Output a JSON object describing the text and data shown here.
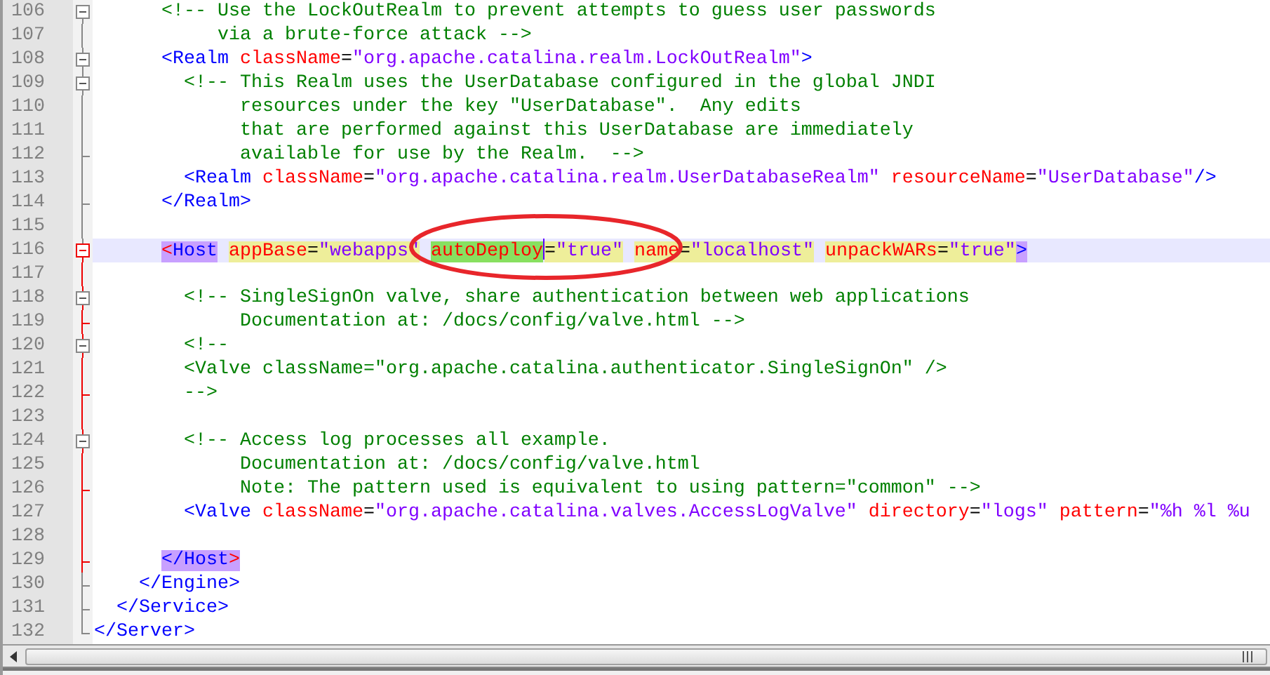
{
  "editor": {
    "lines": [
      {
        "number": "106",
        "fold": {
          "kind": "open",
          "active": false
        },
        "current": false,
        "tokens": [
          {
            "kind": "comment",
            "text": "      <!-- Use the LockOutRealm to prevent attempts to guess user passwords"
          }
        ]
      },
      {
        "number": "107",
        "fold": {
          "kind": "line",
          "active": false
        },
        "current": false,
        "tokens": [
          {
            "kind": "comment",
            "text": "           via a brute-force attack -->"
          }
        ]
      },
      {
        "number": "108",
        "fold": {
          "kind": "open",
          "active": false
        },
        "current": false,
        "tokens": [
          {
            "kind": "tag",
            "text": "      <Realm"
          },
          {
            "kind": "attr",
            "text": " className"
          },
          {
            "kind": "eq",
            "text": "="
          },
          {
            "kind": "value",
            "text": "\"org.apache.catalina.realm.LockOutRealm\""
          },
          {
            "kind": "tag",
            "text": ">"
          }
        ]
      },
      {
        "number": "109",
        "fold": {
          "kind": "open",
          "active": false
        },
        "current": false,
        "tokens": [
          {
            "kind": "comment",
            "text": "        <!-- This Realm uses the UserDatabase configured in the global JNDI"
          }
        ]
      },
      {
        "number": "110",
        "fold": {
          "kind": "line",
          "active": false
        },
        "current": false,
        "tokens": [
          {
            "kind": "comment",
            "text": "             resources under the key \"UserDatabase\".  Any edits"
          }
        ]
      },
      {
        "number": "111",
        "fold": {
          "kind": "line",
          "active": false
        },
        "current": false,
        "tokens": [
          {
            "kind": "comment",
            "text": "             that are performed against this UserDatabase are immediately"
          }
        ]
      },
      {
        "number": "112",
        "fold": {
          "kind": "end",
          "active": false
        },
        "current": false,
        "tokens": [
          {
            "kind": "comment",
            "text": "             available for use by the Realm.  -->"
          }
        ]
      },
      {
        "number": "113",
        "fold": {
          "kind": "line",
          "active": false
        },
        "current": false,
        "tokens": [
          {
            "kind": "tag",
            "text": "        <Realm"
          },
          {
            "kind": "attr",
            "text": " className"
          },
          {
            "kind": "eq",
            "text": "="
          },
          {
            "kind": "value",
            "text": "\"org.apache.catalina.realm.UserDatabaseRealm\""
          },
          {
            "kind": "attr",
            "text": " resourceName"
          },
          {
            "kind": "eq",
            "text": "="
          },
          {
            "kind": "value",
            "text": "\"UserDatabase\""
          },
          {
            "kind": "tag",
            "text": "/>"
          }
        ]
      },
      {
        "number": "114",
        "fold": {
          "kind": "end",
          "active": false
        },
        "current": false,
        "tokens": [
          {
            "kind": "tag",
            "text": "      </Realm>"
          }
        ]
      },
      {
        "number": "115",
        "fold": {
          "kind": "line",
          "active": false
        },
        "current": false
      },
      {
        "number": "116",
        "fold": {
          "kind": "head",
          "active": true
        },
        "current": true,
        "tokens": [
          {
            "kind": "bracket",
            "text": "      <",
            "brace_match": true
          },
          {
            "kind": "tag",
            "text": "Host",
            "brace_match": true
          },
          {
            "kind": "attr",
            "text": " appBase",
            "smart_match": true
          },
          {
            "kind": "eq",
            "text": "=",
            "smart_match": true
          },
          {
            "kind": "value",
            "text": "\"webapps\"",
            "smart_match": true
          },
          {
            "kind": "attr",
            "text": " autoDeploy",
            "selected": true,
            "caret": true
          },
          {
            "kind": "eq",
            "text": "=",
            "smart_match": true
          },
          {
            "kind": "value",
            "text": "\"true\"",
            "smart_match": true
          },
          {
            "kind": "attr",
            "text": " name",
            "smart_match": true
          },
          {
            "kind": "eq",
            "text": "=",
            "smart_match": true
          },
          {
            "kind": "value",
            "text": "\"localhost\"",
            "smart_match": true
          },
          {
            "kind": "attr",
            "text": " unpackWARs",
            "smart_match": true
          },
          {
            "kind": "eq",
            "text": "=",
            "smart_match": true
          },
          {
            "kind": "value",
            "text": "\"true\"",
            "smart_match": true
          },
          {
            "kind": "tag",
            "text": ">",
            "brace_match": true
          }
        ]
      },
      {
        "number": "117",
        "fold": {
          "kind": "line",
          "active": true
        },
        "current": false
      },
      {
        "number": "118",
        "fold": {
          "kind": "open",
          "active": true
        },
        "current": false,
        "tokens": [
          {
            "kind": "comment",
            "text": "        <!-- SingleSignOn valve, share authentication between web applications"
          }
        ]
      },
      {
        "number": "119",
        "fold": {
          "kind": "end",
          "active": true
        },
        "current": false,
        "tokens": [
          {
            "kind": "comment",
            "text": "             Documentation at: /docs/config/valve.html -->"
          }
        ]
      },
      {
        "number": "120",
        "fold": {
          "kind": "open",
          "active": true
        },
        "current": false,
        "tokens": [
          {
            "kind": "comment",
            "text": "        <!--"
          }
        ]
      },
      {
        "number": "121",
        "fold": {
          "kind": "line",
          "active": true
        },
        "current": false,
        "tokens": [
          {
            "kind": "comment",
            "text": "        <Valve className=\"org.apache.catalina.authenticator.SingleSignOn\" />"
          }
        ]
      },
      {
        "number": "122",
        "fold": {
          "kind": "end",
          "active": true
        },
        "current": false,
        "tokens": [
          {
            "kind": "comment",
            "text": "        -->"
          }
        ]
      },
      {
        "number": "123",
        "fold": {
          "kind": "line",
          "active": true
        },
        "current": false
      },
      {
        "number": "124",
        "fold": {
          "kind": "open",
          "active": true
        },
        "current": false,
        "tokens": [
          {
            "kind": "comment",
            "text": "        <!-- Access log processes all example."
          }
        ]
      },
      {
        "number": "125",
        "fold": {
          "kind": "line",
          "active": true
        },
        "current": false,
        "tokens": [
          {
            "kind": "comment",
            "text": "             Documentation at: /docs/config/valve.html"
          }
        ]
      },
      {
        "number": "126",
        "fold": {
          "kind": "end",
          "active": true
        },
        "current": false,
        "tokens": [
          {
            "kind": "comment",
            "text": "             Note: The pattern used is equivalent to using pattern=\"common\" -->"
          }
        ]
      },
      {
        "number": "127",
        "fold": {
          "kind": "line",
          "active": true
        },
        "current": false,
        "tokens": [
          {
            "kind": "tag",
            "text": "        <Valve"
          },
          {
            "kind": "attr",
            "text": " className"
          },
          {
            "kind": "eq",
            "text": "="
          },
          {
            "kind": "value",
            "text": "\"org.apache.catalina.valves.AccessLogValve\""
          },
          {
            "kind": "attr",
            "text": " directory"
          },
          {
            "kind": "eq",
            "text": "="
          },
          {
            "kind": "value",
            "text": "\"logs\""
          },
          {
            "kind": "attr",
            "text": " pattern"
          },
          {
            "kind": "eq",
            "text": "="
          },
          {
            "kind": "value",
            "text": "\"%h %l %u"
          }
        ]
      },
      {
        "number": "128",
        "fold": {
          "kind": "line",
          "active": true
        },
        "current": false
      },
      {
        "number": "129",
        "fold": {
          "kind": "end",
          "active": true
        },
        "current": false,
        "tokens": [
          {
            "kind": "tag",
            "text": "      </Host",
            "brace_match": true
          },
          {
            "kind": "bracket",
            "text": ">",
            "brace_match": true
          }
        ]
      },
      {
        "number": "130",
        "fold": {
          "kind": "end",
          "active": false
        },
        "current": false,
        "tokens": [
          {
            "kind": "tag",
            "text": "    </Engine>"
          }
        ]
      },
      {
        "number": "131",
        "fold": {
          "kind": "end",
          "active": false
        },
        "current": false,
        "tokens": [
          {
            "kind": "tag",
            "text": "  </Service>"
          }
        ]
      },
      {
        "number": "132",
        "fold": {
          "kind": "last",
          "active": false
        },
        "current": false,
        "tokens": [
          {
            "kind": "tag",
            "text": "</Server>"
          }
        ]
      }
    ]
  }
}
